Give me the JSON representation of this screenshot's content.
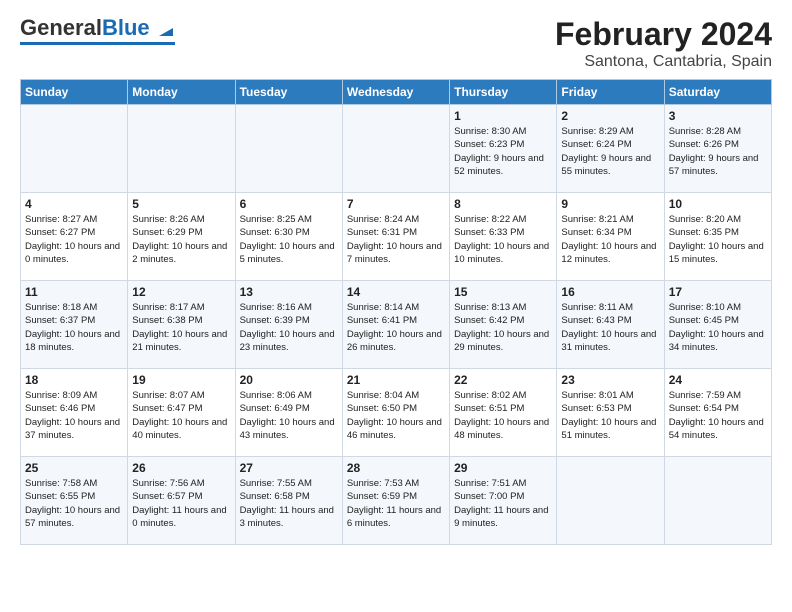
{
  "header": {
    "logo_general": "General",
    "logo_blue": "Blue",
    "title": "February 2024",
    "subtitle": "Santona, Cantabria, Spain"
  },
  "days_of_week": [
    "Sunday",
    "Monday",
    "Tuesday",
    "Wednesday",
    "Thursday",
    "Friday",
    "Saturday"
  ],
  "weeks": [
    [
      {
        "day": "",
        "info": ""
      },
      {
        "day": "",
        "info": ""
      },
      {
        "day": "",
        "info": ""
      },
      {
        "day": "",
        "info": ""
      },
      {
        "day": "1",
        "info": "Sunrise: 8:30 AM\nSunset: 6:23 PM\nDaylight: 9 hours\nand 52 minutes."
      },
      {
        "day": "2",
        "info": "Sunrise: 8:29 AM\nSunset: 6:24 PM\nDaylight: 9 hours\nand 55 minutes."
      },
      {
        "day": "3",
        "info": "Sunrise: 8:28 AM\nSunset: 6:26 PM\nDaylight: 9 hours\nand 57 minutes."
      }
    ],
    [
      {
        "day": "4",
        "info": "Sunrise: 8:27 AM\nSunset: 6:27 PM\nDaylight: 10 hours\nand 0 minutes."
      },
      {
        "day": "5",
        "info": "Sunrise: 8:26 AM\nSunset: 6:29 PM\nDaylight: 10 hours\nand 2 minutes."
      },
      {
        "day": "6",
        "info": "Sunrise: 8:25 AM\nSunset: 6:30 PM\nDaylight: 10 hours\nand 5 minutes."
      },
      {
        "day": "7",
        "info": "Sunrise: 8:24 AM\nSunset: 6:31 PM\nDaylight: 10 hours\nand 7 minutes."
      },
      {
        "day": "8",
        "info": "Sunrise: 8:22 AM\nSunset: 6:33 PM\nDaylight: 10 hours\nand 10 minutes."
      },
      {
        "day": "9",
        "info": "Sunrise: 8:21 AM\nSunset: 6:34 PM\nDaylight: 10 hours\nand 12 minutes."
      },
      {
        "day": "10",
        "info": "Sunrise: 8:20 AM\nSunset: 6:35 PM\nDaylight: 10 hours\nand 15 minutes."
      }
    ],
    [
      {
        "day": "11",
        "info": "Sunrise: 8:18 AM\nSunset: 6:37 PM\nDaylight: 10 hours\nand 18 minutes."
      },
      {
        "day": "12",
        "info": "Sunrise: 8:17 AM\nSunset: 6:38 PM\nDaylight: 10 hours\nand 21 minutes."
      },
      {
        "day": "13",
        "info": "Sunrise: 8:16 AM\nSunset: 6:39 PM\nDaylight: 10 hours\nand 23 minutes."
      },
      {
        "day": "14",
        "info": "Sunrise: 8:14 AM\nSunset: 6:41 PM\nDaylight: 10 hours\nand 26 minutes."
      },
      {
        "day": "15",
        "info": "Sunrise: 8:13 AM\nSunset: 6:42 PM\nDaylight: 10 hours\nand 29 minutes."
      },
      {
        "day": "16",
        "info": "Sunrise: 8:11 AM\nSunset: 6:43 PM\nDaylight: 10 hours\nand 31 minutes."
      },
      {
        "day": "17",
        "info": "Sunrise: 8:10 AM\nSunset: 6:45 PM\nDaylight: 10 hours\nand 34 minutes."
      }
    ],
    [
      {
        "day": "18",
        "info": "Sunrise: 8:09 AM\nSunset: 6:46 PM\nDaylight: 10 hours\nand 37 minutes."
      },
      {
        "day": "19",
        "info": "Sunrise: 8:07 AM\nSunset: 6:47 PM\nDaylight: 10 hours\nand 40 minutes."
      },
      {
        "day": "20",
        "info": "Sunrise: 8:06 AM\nSunset: 6:49 PM\nDaylight: 10 hours\nand 43 minutes."
      },
      {
        "day": "21",
        "info": "Sunrise: 8:04 AM\nSunset: 6:50 PM\nDaylight: 10 hours\nand 46 minutes."
      },
      {
        "day": "22",
        "info": "Sunrise: 8:02 AM\nSunset: 6:51 PM\nDaylight: 10 hours\nand 48 minutes."
      },
      {
        "day": "23",
        "info": "Sunrise: 8:01 AM\nSunset: 6:53 PM\nDaylight: 10 hours\nand 51 minutes."
      },
      {
        "day": "24",
        "info": "Sunrise: 7:59 AM\nSunset: 6:54 PM\nDaylight: 10 hours\nand 54 minutes."
      }
    ],
    [
      {
        "day": "25",
        "info": "Sunrise: 7:58 AM\nSunset: 6:55 PM\nDaylight: 10 hours\nand 57 minutes."
      },
      {
        "day": "26",
        "info": "Sunrise: 7:56 AM\nSunset: 6:57 PM\nDaylight: 11 hours\nand 0 minutes."
      },
      {
        "day": "27",
        "info": "Sunrise: 7:55 AM\nSunset: 6:58 PM\nDaylight: 11 hours\nand 3 minutes."
      },
      {
        "day": "28",
        "info": "Sunrise: 7:53 AM\nSunset: 6:59 PM\nDaylight: 11 hours\nand 6 minutes."
      },
      {
        "day": "29",
        "info": "Sunrise: 7:51 AM\nSunset: 7:00 PM\nDaylight: 11 hours\nand 9 minutes."
      },
      {
        "day": "",
        "info": ""
      },
      {
        "day": "",
        "info": ""
      }
    ]
  ]
}
